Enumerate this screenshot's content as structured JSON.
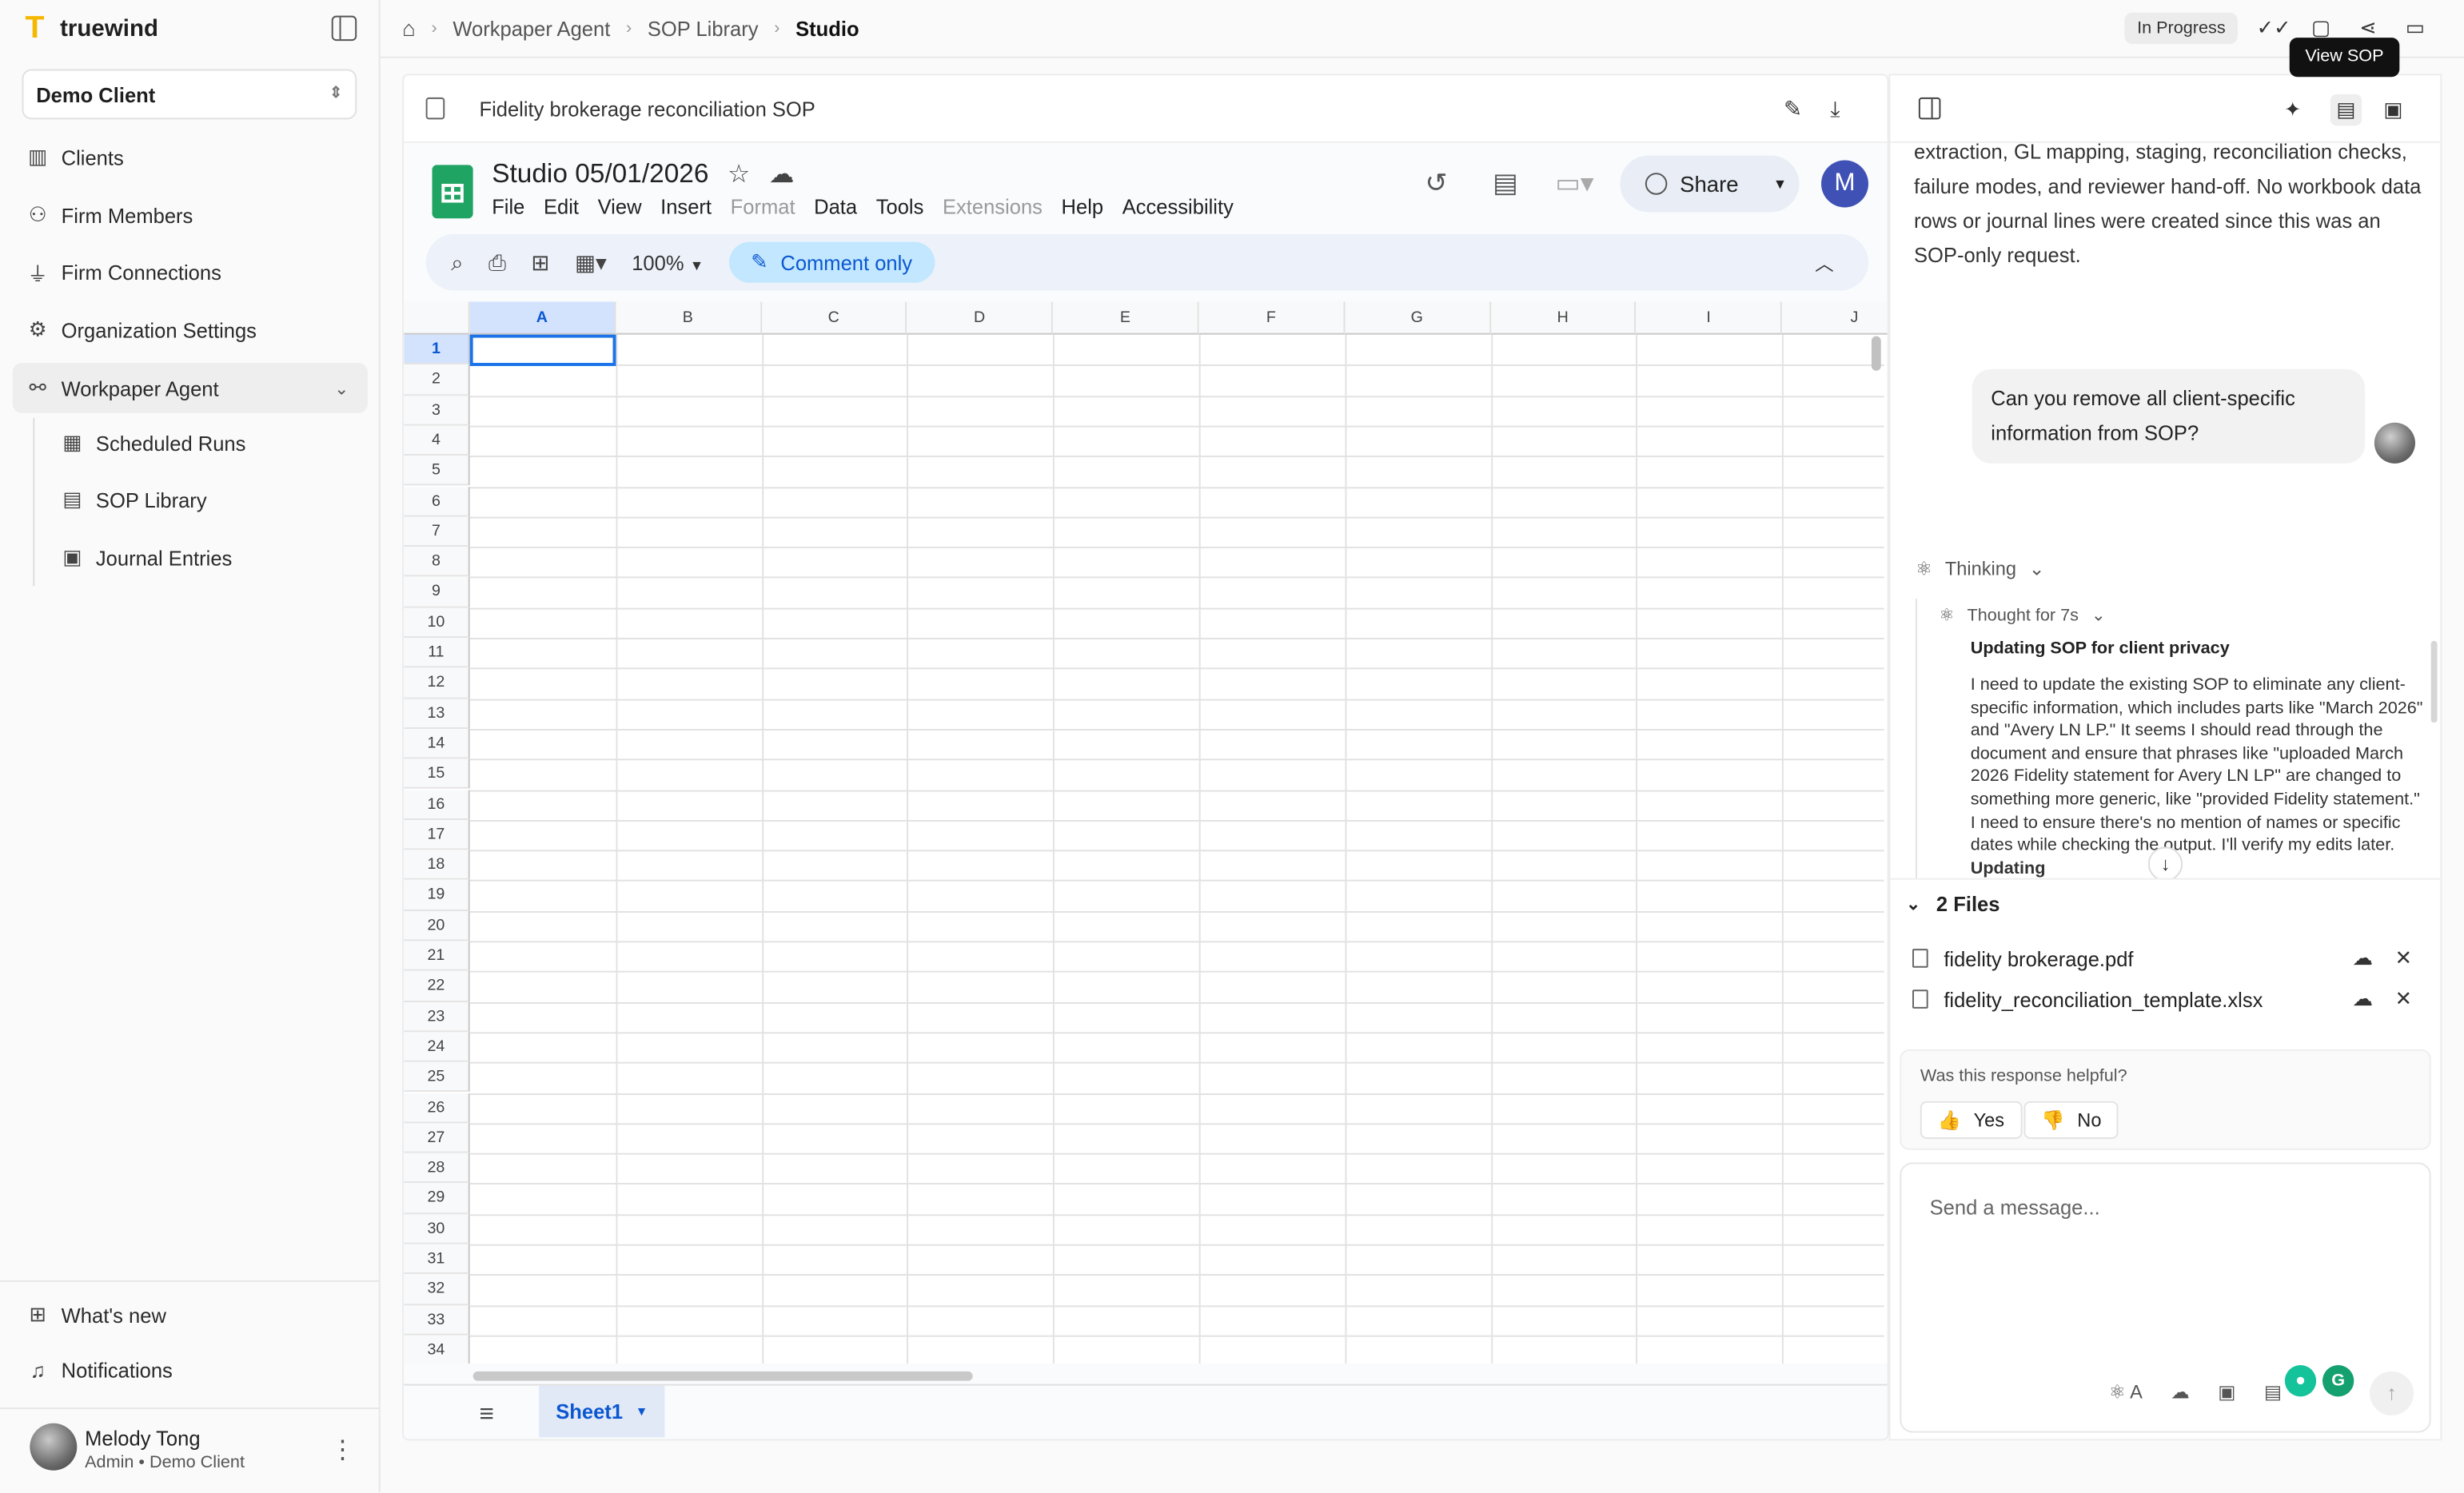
{
  "app": {
    "name": "truewind",
    "client": "Demo Client"
  },
  "sidebar": {
    "items": [
      {
        "label": "Clients"
      },
      {
        "label": "Firm Members"
      },
      {
        "label": "Firm Connections"
      },
      {
        "label": "Organization Settings"
      },
      {
        "label": "Workpaper Agent"
      },
      {
        "label": "Scheduled Runs"
      },
      {
        "label": "SOP Library"
      },
      {
        "label": "Journal Entries"
      }
    ],
    "footer": [
      {
        "label": "What's new"
      },
      {
        "label": "Notifications"
      }
    ],
    "user": {
      "name": "Melody Tong",
      "role": "Admin • Demo Client"
    }
  },
  "breadcrumb": [
    "Workpaper Agent",
    "SOP Library",
    "Studio"
  ],
  "status": "In Progress",
  "tooltip": "View SOP",
  "sop": {
    "title": "Fidelity brokerage reconciliation SOP"
  },
  "sheet": {
    "title": "Studio 05/01/2026",
    "menus": [
      "File",
      "Edit",
      "View",
      "Insert",
      "Format",
      "Data",
      "Tools",
      "Extensions",
      "Help",
      "Accessibility"
    ],
    "disabled_menus": [
      "Format",
      "Extensions"
    ],
    "share_label": "Share",
    "avatar_letter": "M",
    "zoom": "100%",
    "mode": "Comment only",
    "columns": [
      "A",
      "B",
      "C",
      "D",
      "E",
      "F",
      "G",
      "H",
      "I",
      "J"
    ],
    "rows": 34,
    "selected_cell": "A1",
    "tab": "Sheet1"
  },
  "chat": {
    "prev_text": "extraction, GL mapping, staging, reconciliation checks, failure modes, and reviewer hand-off. No workbook data rows or journal lines were created since this was an SOP-only request.",
    "user_message": "Can you remove all client-specific information from SOP?",
    "thinking_label": "Thinking",
    "thought_label": "Thought for 7s",
    "thought_title": "Updating SOP for client privacy",
    "thought_body": "I need to update the existing SOP to eliminate any client-specific information, which includes parts like \"March 2026\" and \"Avery LN LP.\" It seems I should read through the document and ensure that phrases like \"uploaded March 2026 Fidelity statement for Avery LN LP\" are changed to something more generic, like \"provided Fidelity statement.\" I need to ensure there's no mention of names or specific dates while checking the output. I'll verify my edits later.",
    "thought_tail": "Updating",
    "files_label": "2 Files",
    "files": [
      "fidelity brokerage.pdf",
      "fidelity_reconciliation_template.xlsx"
    ],
    "feedback_q": "Was this response helpful?",
    "yes": "Yes",
    "no": "No",
    "placeholder": "Send a message...",
    "lang_letter": "A"
  }
}
